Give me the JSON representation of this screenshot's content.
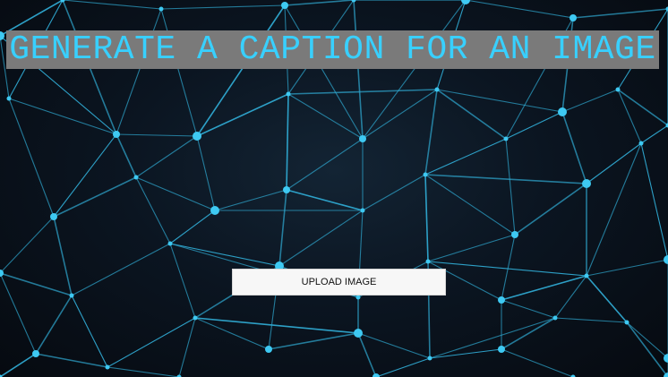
{
  "page": {
    "title": "GENERATE A CAPTION FOR AN IMAGE",
    "upload_label": "UPLOAD IMAGE"
  },
  "background": {
    "description_icon": "polygon-network-background",
    "line_color": "#2fa8d0",
    "node_color": "#3ec9f2",
    "base_color": "#0b1521"
  },
  "colors": {
    "title_text": "#38d0ff",
    "title_banner": "#7a7a7a",
    "button_bg": "#f7f7f7",
    "button_text": "#111111"
  }
}
